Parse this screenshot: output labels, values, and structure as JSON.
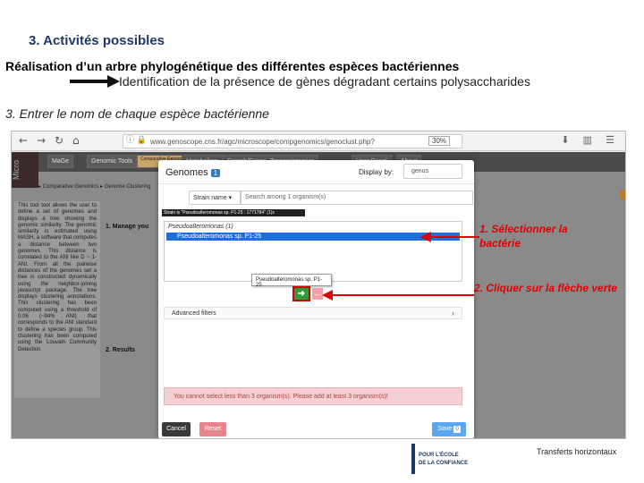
{
  "slide": {
    "section_title": "3. Activités possibles",
    "main_heading": "Réalisation d’un arbre phylogénétique des différentes espèces bactériennes",
    "sub_heading": "Identification de la présence de gènes dégradant certains polysaccharides",
    "step_text": "3. Entrer le nom de chaque espèce bactérienne",
    "annotation_1": "1. Sélectionner la bactérie",
    "annotation_2": "2. Cliquer sur la flèche verte",
    "footer_text": "Transferts horizontaux",
    "logo_line_1": "POUR L'ÉCOLE",
    "logo_line_2": "DE LA CONFIANCE",
    "accent_color": "#e00000",
    "title_color": "#1f3864"
  },
  "browser": {
    "back_icon": "←",
    "forward_icon": "→",
    "reload_icon": "↻",
    "home_icon": "⌂",
    "url": "www.genoscope.cns.fr/agc/microscope/compgenomics/genoclust.php?",
    "zoom": "30%",
    "right_icons": "⬇ ▥ ☰"
  },
  "site": {
    "logo": "Micro",
    "menu": [
      "MaGe",
      "Genomic Tools",
      "Comparative Genomics",
      "Metabolism",
      "Search/Export",
      "Transcriptomics",
      "User Panel",
      "About"
    ],
    "breadcrumb": "▸ Comparative Genomics ▸ Genome Clustering",
    "side_text": "This tool tool allows the user to define a set of genomes and displays a tree showing the genomic similarity. The genomic similarity is estimated using MASH, a software that computes a distance between two genomes. This distance is correlated to the ANI like D ~ 1-ANI. From all the pairwise distances of the genomes set a tree is constructed dynamically using the neighbor-joining javascript package. The tree displays clustering annotations. This clustering has been computed using a threshold of 0.06 (~94% ANI) that corresponds to the ANI standard to define a species group. This clustering has been computed using the Louvain Community Detection.",
    "manage_label": "1. Manage you",
    "results_label": "2. Results"
  },
  "modal": {
    "title": "Genomes",
    "title_badge": "1",
    "display_by_label": "Display by:",
    "display_by_value": "genus",
    "strain_button": "Strain name ▾",
    "search_placeholder": "Search among 1 organism(s)",
    "strain_tooltip": "Strain is \"Pseudoalteromonas sp. P1-25 : 1771784\" (1)x",
    "list_group": "Pseudoalteromonas (1)",
    "list_item": "Pseudoalteromonas sp. P1-25",
    "hover_tip": "Pseudoalteromonas sp. P1-25",
    "add_icon": "➜",
    "remove_icon": "←",
    "advanced_filters": "Advanced filters",
    "alert": "You cannot select less than 3 organism(s). Please add at least 3 organism(s)!",
    "cancel": "Cancel",
    "reset": "Reset",
    "save": "Save",
    "save_badge": "0"
  }
}
